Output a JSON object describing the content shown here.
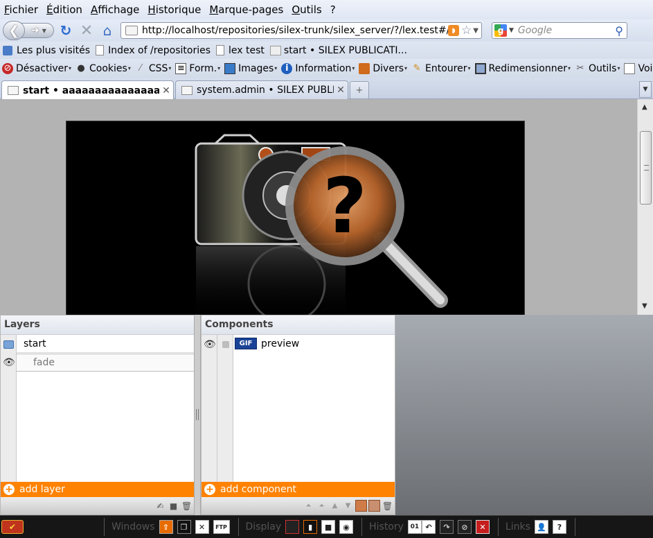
{
  "menu": [
    "Fichier",
    "Édition",
    "Affichage",
    "Historique",
    "Marque-pages",
    "Outils",
    "?"
  ],
  "nav": {
    "url": "http://localhost/repositories/silex-trunk/silex_server/?/lex.test#/start",
    "search_placeholder": "Google"
  },
  "bookmarks": [
    "Les plus visités",
    "Index of /repositories",
    "lex test",
    "start • SILEX PUBLICATI..."
  ],
  "devtoolbar": [
    "Désactiver",
    "Cookies",
    "CSS",
    "Form.",
    "Images",
    "Information",
    "Divers",
    "Entourer",
    "Redimensionner",
    "Outils",
    "Voir So"
  ],
  "tabs": [
    {
      "label": "start • aaaaaaaaaaaaaaa",
      "active": true
    },
    {
      "label": "system.admin • SILEX PUBLI...",
      "active": false
    }
  ],
  "layers": {
    "title": "Layers",
    "items": [
      {
        "label": "start"
      },
      {
        "label": "fade"
      }
    ],
    "add_label": "add layer"
  },
  "components": {
    "title": "Components",
    "items": [
      {
        "badge": "GIF",
        "label": "preview"
      }
    ],
    "add_label": "add component"
  },
  "silexbar": {
    "windows_label": "Windows",
    "display_label": "Display",
    "history_label": "History",
    "links_label": "Links",
    "history_counter": "01",
    "ftp_label": "FTP"
  },
  "colors": {
    "accent_orange": "#ff8200",
    "stage_bg": "#000000",
    "content_bg": "#b3b3b3"
  }
}
